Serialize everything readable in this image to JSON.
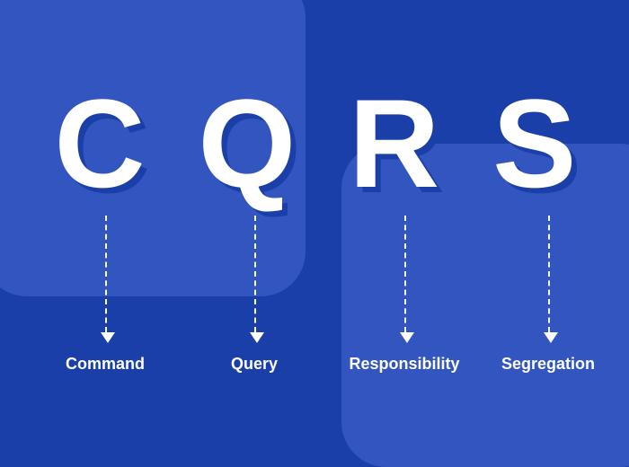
{
  "acronym": {
    "letters": [
      "C",
      "Q",
      "R",
      "S"
    ],
    "expansions": [
      "Command",
      "Query",
      "Responsibility",
      "Segregation"
    ]
  }
}
